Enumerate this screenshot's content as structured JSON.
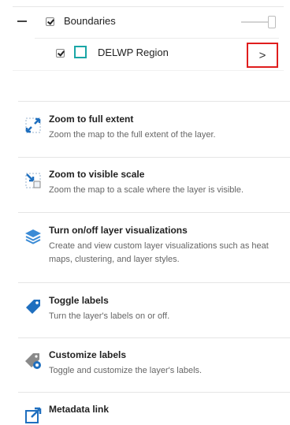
{
  "layers": {
    "group": {
      "label": "Boundaries",
      "checked": true
    },
    "sublayer": {
      "label": "DELWP Region",
      "checked": true,
      "swatch_color": "#1aa6a6"
    },
    "chevron_label": ">"
  },
  "menu": {
    "items": [
      {
        "title": "Zoom to full extent",
        "description": "Zoom the map to the full extent of the layer.",
        "icon": "zoom-full-extent-icon"
      },
      {
        "title": "Zoom to visible scale",
        "description": "Zoom the map to a scale where the layer is visible.",
        "icon": "zoom-visible-scale-icon"
      },
      {
        "title": "Turn on/off layer visualizations",
        "description": "Create and view custom layer visualizations such as heat maps, clustering, and layer styles.",
        "icon": "layers-stack-icon"
      },
      {
        "title": "Toggle labels",
        "description": "Turn the layer's labels on or off.",
        "icon": "tag-icon"
      },
      {
        "title": "Customize labels",
        "description": "Toggle and customize the layer's labels.",
        "icon": "tag-gear-icon"
      },
      {
        "title": "Metadata link",
        "description": "",
        "icon": "external-link-icon"
      }
    ]
  },
  "colors": {
    "accent": "#1f6fbf",
    "highlight_border": "#e01d1d"
  }
}
